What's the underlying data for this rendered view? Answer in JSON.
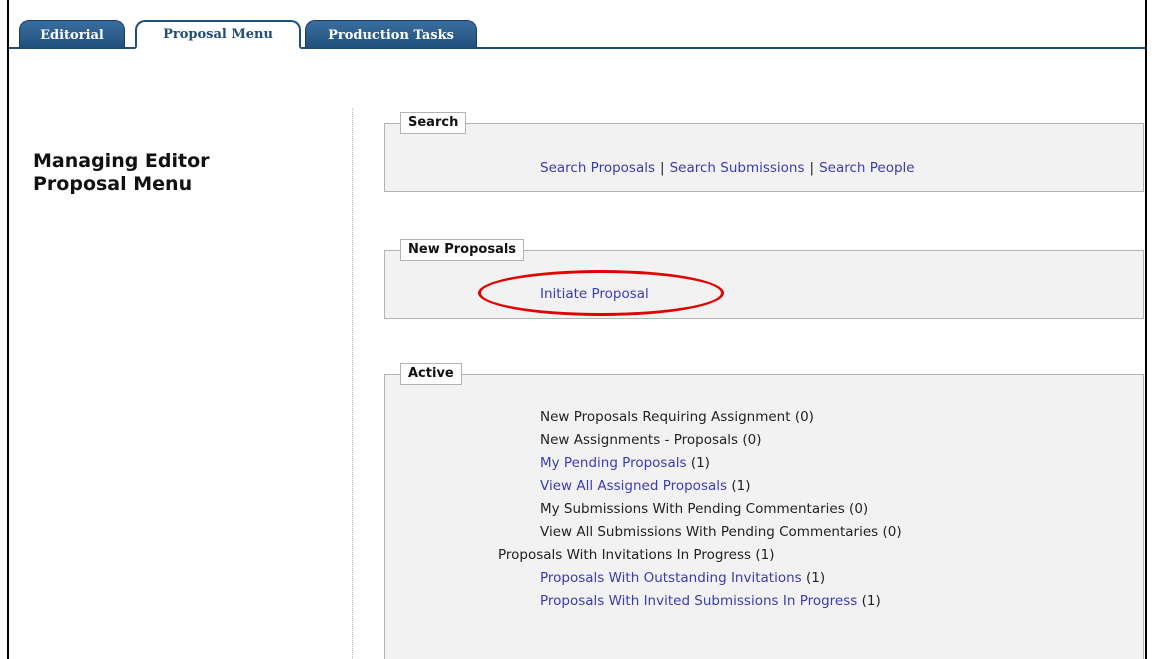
{
  "tabs": [
    {
      "label": "Editorial"
    },
    {
      "label": "Proposal Menu"
    },
    {
      "label": "Production Tasks"
    }
  ],
  "page": {
    "title_line1": "Managing Editor",
    "title_line2": "Proposal Menu"
  },
  "search": {
    "legend": "Search",
    "links": [
      "Search Proposals",
      "Search Submissions",
      "Search People"
    ],
    "separator": "|"
  },
  "new_proposals": {
    "legend": "New Proposals",
    "initiate": "Initiate Proposal"
  },
  "active": {
    "legend": "Active",
    "items": [
      {
        "label": "New Proposals Requiring Assignment",
        "count": "(0)",
        "is_link": false
      },
      {
        "label": "New Assignments - Proposals",
        "count": "(0)",
        "is_link": false
      },
      {
        "label": "My Pending Proposals",
        "count": "(1)",
        "is_link": true
      },
      {
        "label": "View All Assigned Proposals",
        "count": "(1)",
        "is_link": true
      },
      {
        "label": "My Submissions With Pending Commentaries",
        "count": "(0)",
        "is_link": false
      },
      {
        "label": "View All Submissions With Pending Commentaries",
        "count": "(0)",
        "is_link": false
      },
      {
        "label": "Proposals With Invitations In Progress",
        "count": " (1)",
        "is_link": false
      },
      {
        "label": "Proposals With Outstanding Invitations",
        "count": "(1)",
        "is_link": true
      },
      {
        "label": "Proposals With Invited Submissions In Progress",
        "count": "(1)",
        "is_link": true
      }
    ]
  },
  "colors": {
    "tab_dark": "#1f4e79",
    "link": "#3b3bb3",
    "highlight": "#e00000",
    "box_bg": "#f2f2f2"
  }
}
